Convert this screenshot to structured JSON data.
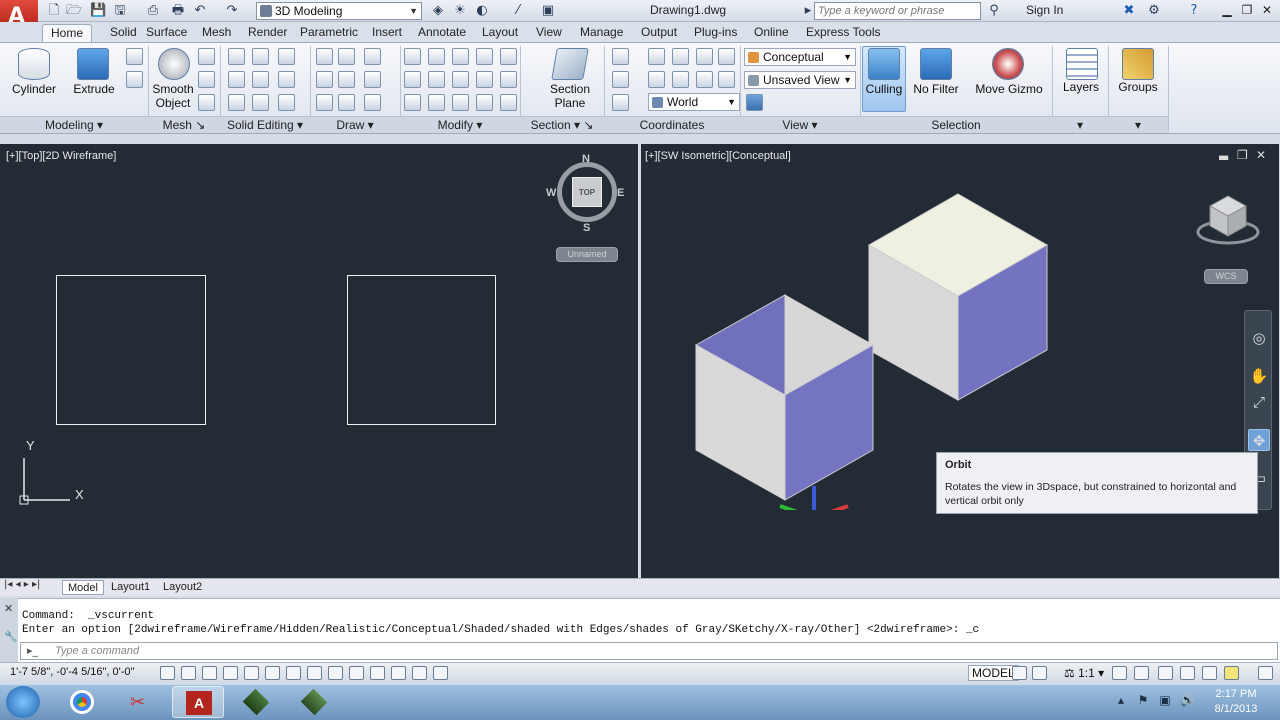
{
  "titlebar": {
    "workspace": "3D Modeling",
    "document": "Drawing1.dwg",
    "search_placeholder": "Type a keyword or phrase",
    "signin": "Sign In"
  },
  "tabs": [
    "Home",
    "Solid",
    "Surface",
    "Mesh",
    "Render",
    "Parametric",
    "Insert",
    "Annotate",
    "Layout",
    "View",
    "Manage",
    "Output",
    "Plug-ins",
    "Online",
    "Express Tools"
  ],
  "ribbon": {
    "modeling": {
      "cylinder": "Cylinder",
      "extrude": "Extrude",
      "smooth_object_1": "Smooth",
      "smooth_object_2": "Object",
      "title": "Modeling"
    },
    "mesh_title": "Mesh",
    "solid_editing_title": "Solid Editing",
    "draw_title": "Draw",
    "modify_title": "Modify",
    "section": {
      "section_plane_1": "Section",
      "section_plane_2": "Plane",
      "title": "Section"
    },
    "coordinates": {
      "title": "Coordinates",
      "world": "World"
    },
    "view": {
      "visual_style": "Conceptual",
      "named_view": "Unsaved View",
      "title": "View"
    },
    "selection": {
      "culling": "Culling",
      "no_filter": "No Filter",
      "move_gizmo": "Move Gizmo",
      "title": "Selection"
    },
    "layers": "Layers",
    "groups": "Groups"
  },
  "viewports": {
    "left_label": "[+][Top][2D Wireframe]",
    "right_label": "[+][SW Isometric][Conceptual]",
    "viewcube": {
      "top": "TOP",
      "n": "N",
      "s": "S",
      "e": "E",
      "w": "W",
      "ucs": "Unnamed"
    },
    "wcs": "WCS",
    "ucs_y": "Y",
    "ucs_x": "X"
  },
  "tooltip": {
    "title": "Orbit",
    "body": "Rotates the view in 3Dspace, but constrained to horizontal and vertical orbit only"
  },
  "layout_tabs": [
    "Model",
    "Layout1",
    "Layout2"
  ],
  "command": {
    "line1": "Command:  _vscurrent",
    "line2": "Enter an option [2dwireframe/Wireframe/Hidden/Realistic/Conceptual/Shaded/shaded with Edges/shades of Gray/SKetchy/X-ray/Other] <2dwireframe>: _c",
    "placeholder": "Type a command"
  },
  "statusbar": {
    "coords": "1'-7 5/8\",  -0'-4 5/16\", 0'-0\"",
    "model": "MODEL",
    "scale": "1:1"
  },
  "taskbar": {
    "time": "2:17 PM",
    "date": "8/1/2013"
  },
  "colors": {
    "viewport_bg": "#232c35",
    "cube_face_side": "#7272c0",
    "cube_face_light": "#d8d8d8",
    "cube_top": "#f0f0e4"
  }
}
